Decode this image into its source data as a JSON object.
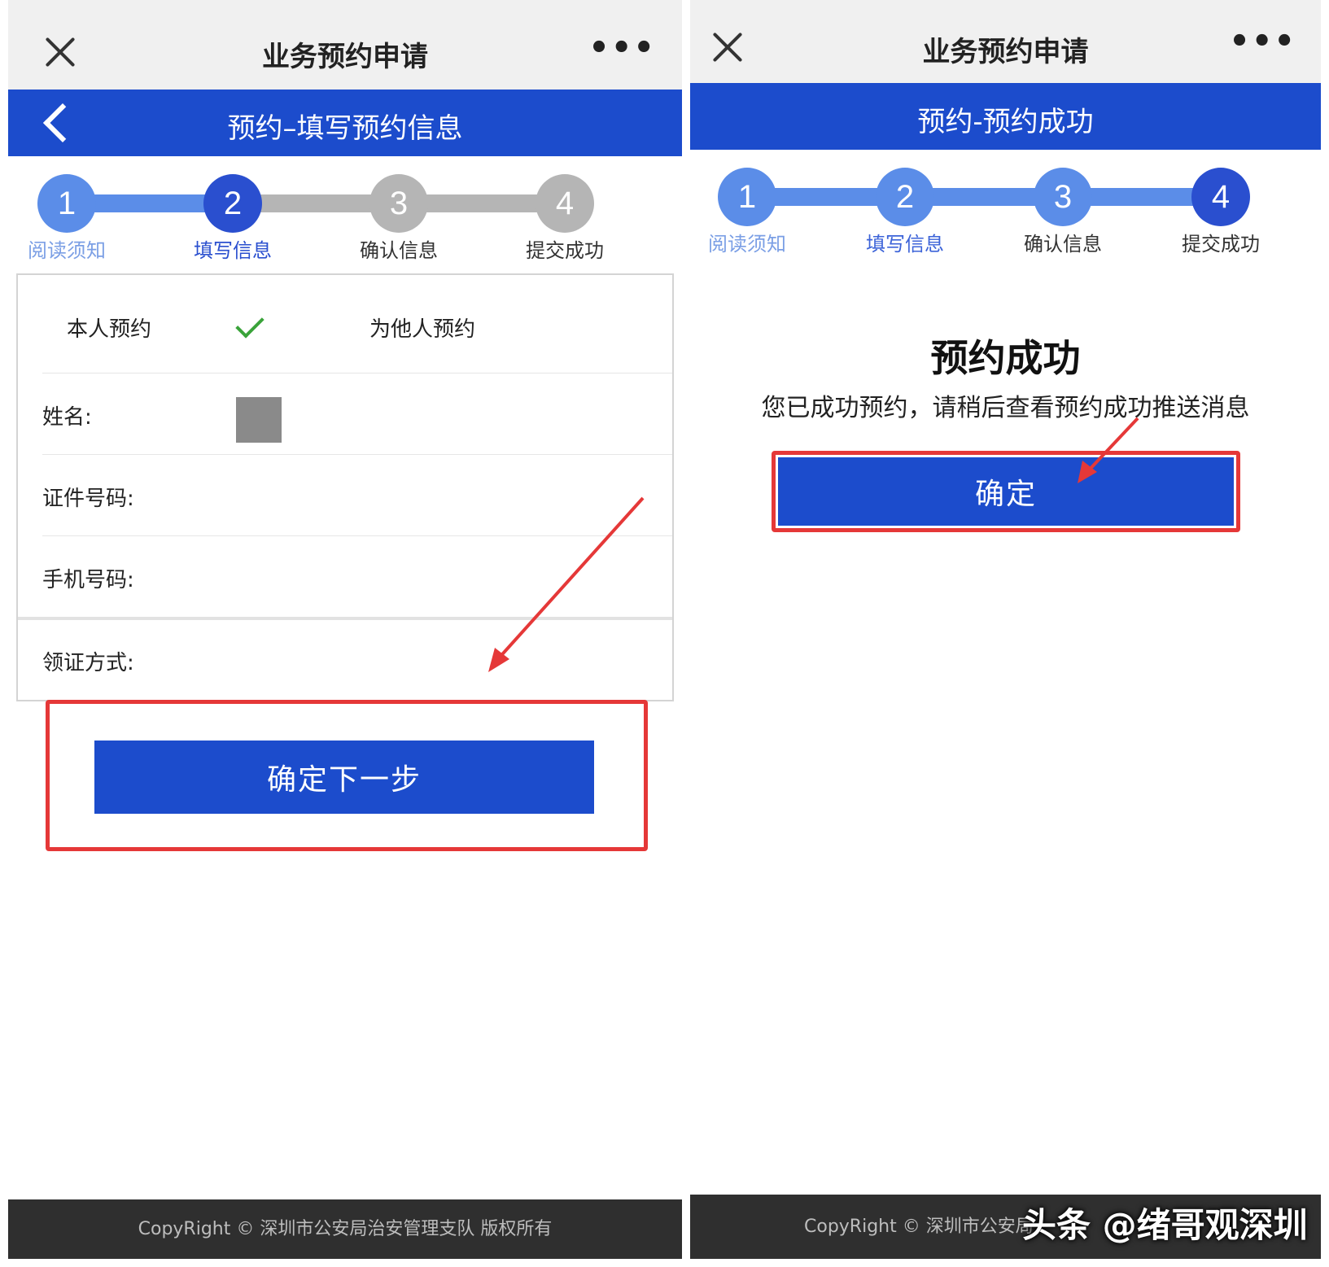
{
  "colors": {
    "accent_blue": "#1c4ccc",
    "step_active": "#5b8de8",
    "step_inactive": "#b5b5b5",
    "highlight_red": "#e53838",
    "check_green": "#3aa33a",
    "footer_bg": "#2f2f2f"
  },
  "left": {
    "topbar": {
      "title": "业务预约申请",
      "close_icon": "close-icon",
      "more": "•••"
    },
    "header": {
      "title": "预约–填写预约信息",
      "back_icon": "chevron-left-icon"
    },
    "steps": [
      {
        "num": "1",
        "label": "阅读须知",
        "state": "done"
      },
      {
        "num": "2",
        "label": "填写信息",
        "state": "current"
      },
      {
        "num": "3",
        "label": "确认信息",
        "state": "todo"
      },
      {
        "num": "4",
        "label": "提交成功",
        "state": "todo"
      }
    ],
    "form": {
      "self_option": "本人预约",
      "other_option": "为他人预约",
      "name_label": "姓名:",
      "id_label": "证件号码:",
      "phone_label": "手机号码:",
      "pickup_label": "领证方式:"
    },
    "next_button": "确定下一步",
    "footer": "CopyRight © 深圳市公安局治安管理支队 版权所有"
  },
  "right": {
    "topbar": {
      "title": "业务预约申请",
      "close_icon": "close-icon",
      "more": "•••"
    },
    "header": {
      "title": "预约-预约成功"
    },
    "steps": [
      {
        "num": "1",
        "label": "阅读须知",
        "state": "done"
      },
      {
        "num": "2",
        "label": "填写信息",
        "state": "done"
      },
      {
        "num": "3",
        "label": "确认信息",
        "state": "done"
      },
      {
        "num": "4",
        "label": "提交成功",
        "state": "current"
      }
    ],
    "success_title": "预约成功",
    "success_message": "您已成功预约，请稍后查看预约成功推送消息",
    "confirm_button": "确定",
    "footer": "CopyRight © 深圳市公安局",
    "watermark": "头条 @绪哥观深圳"
  }
}
